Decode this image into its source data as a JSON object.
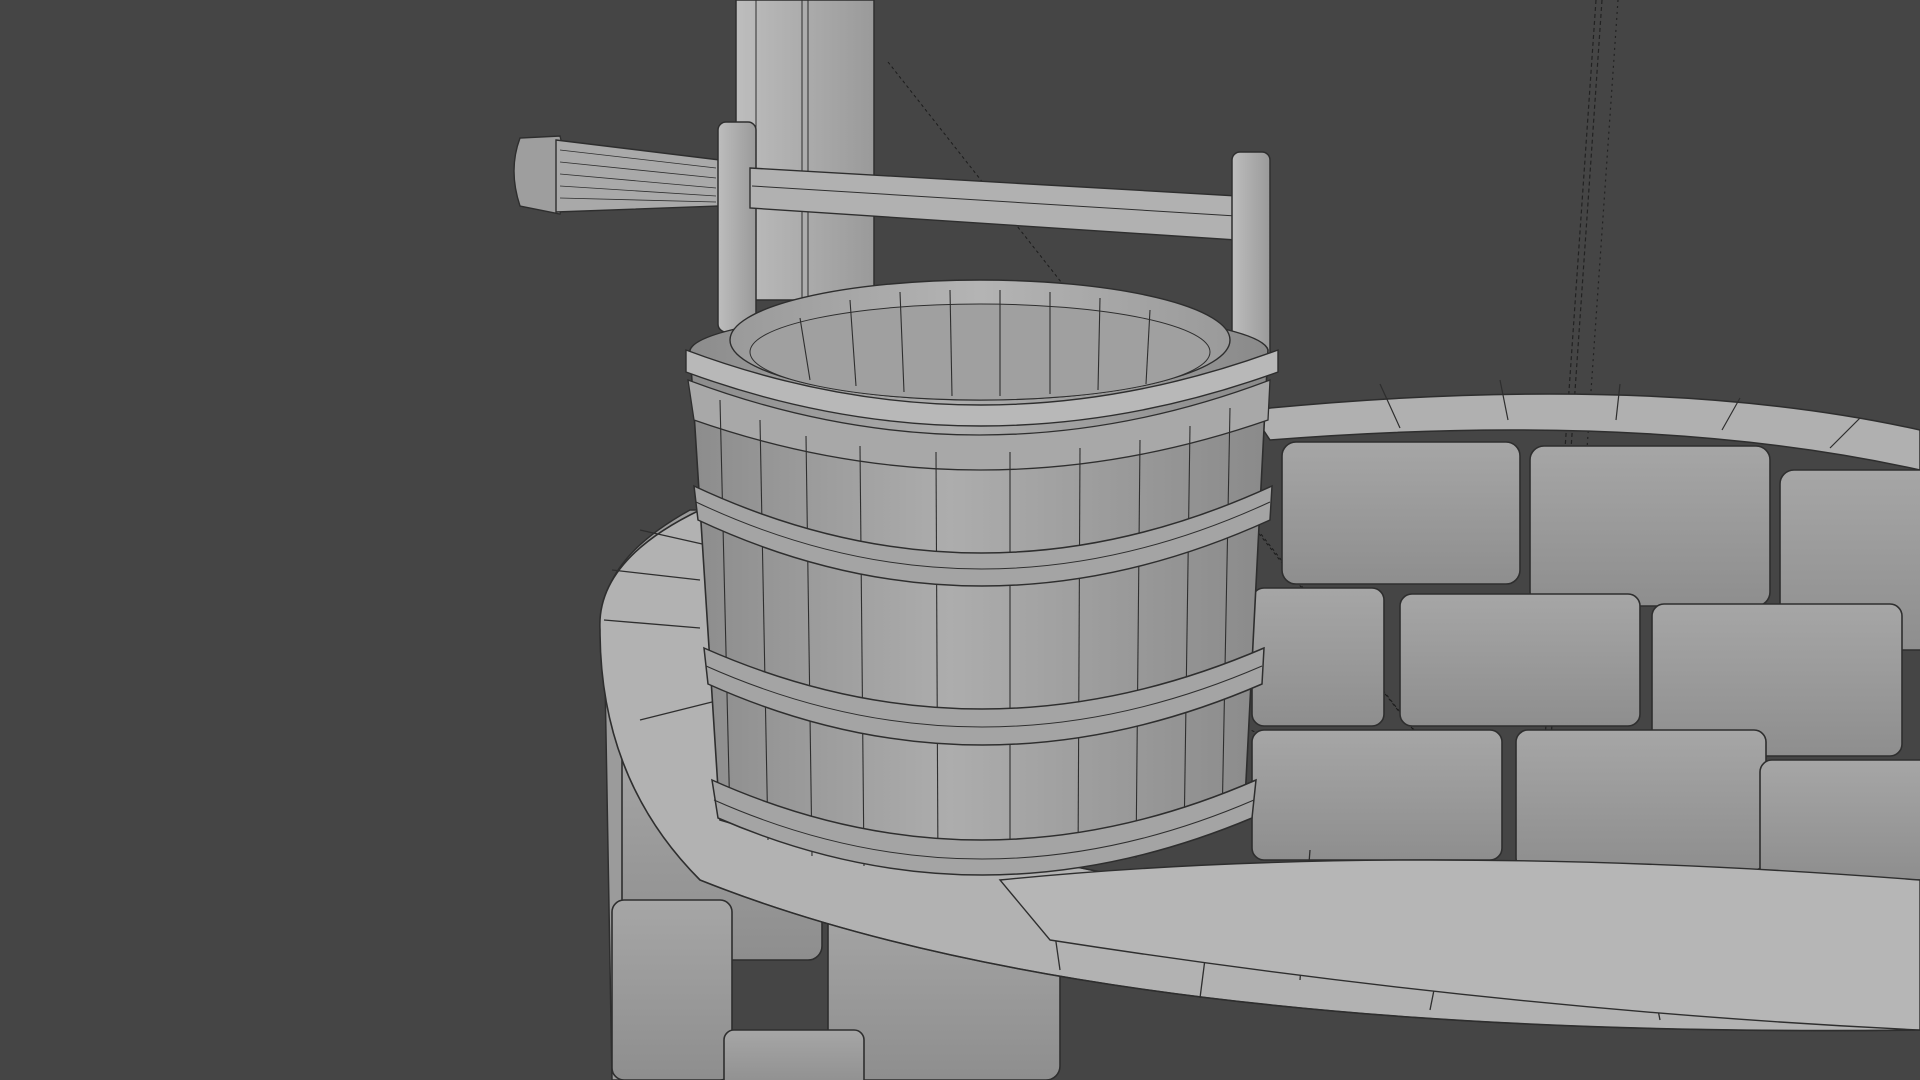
{
  "viewport": {
    "background": "#454545",
    "render_mode": "wireframe-on-shaded",
    "surface_color": "#a3a3a3",
    "edge_color": "#2a2a2a"
  },
  "objects": [
    {
      "name": "well-wall",
      "kind": "stone-brick-ring"
    },
    {
      "name": "well-rim",
      "kind": "stone-cap-ring"
    },
    {
      "name": "bucket",
      "kind": "wooden-stave-bucket",
      "hoops": 3
    },
    {
      "name": "windlass",
      "kind": "crank-axle-with-handle"
    },
    {
      "name": "support-post",
      "kind": "wooden-post"
    },
    {
      "name": "rope",
      "kind": "hanging-rope"
    }
  ]
}
